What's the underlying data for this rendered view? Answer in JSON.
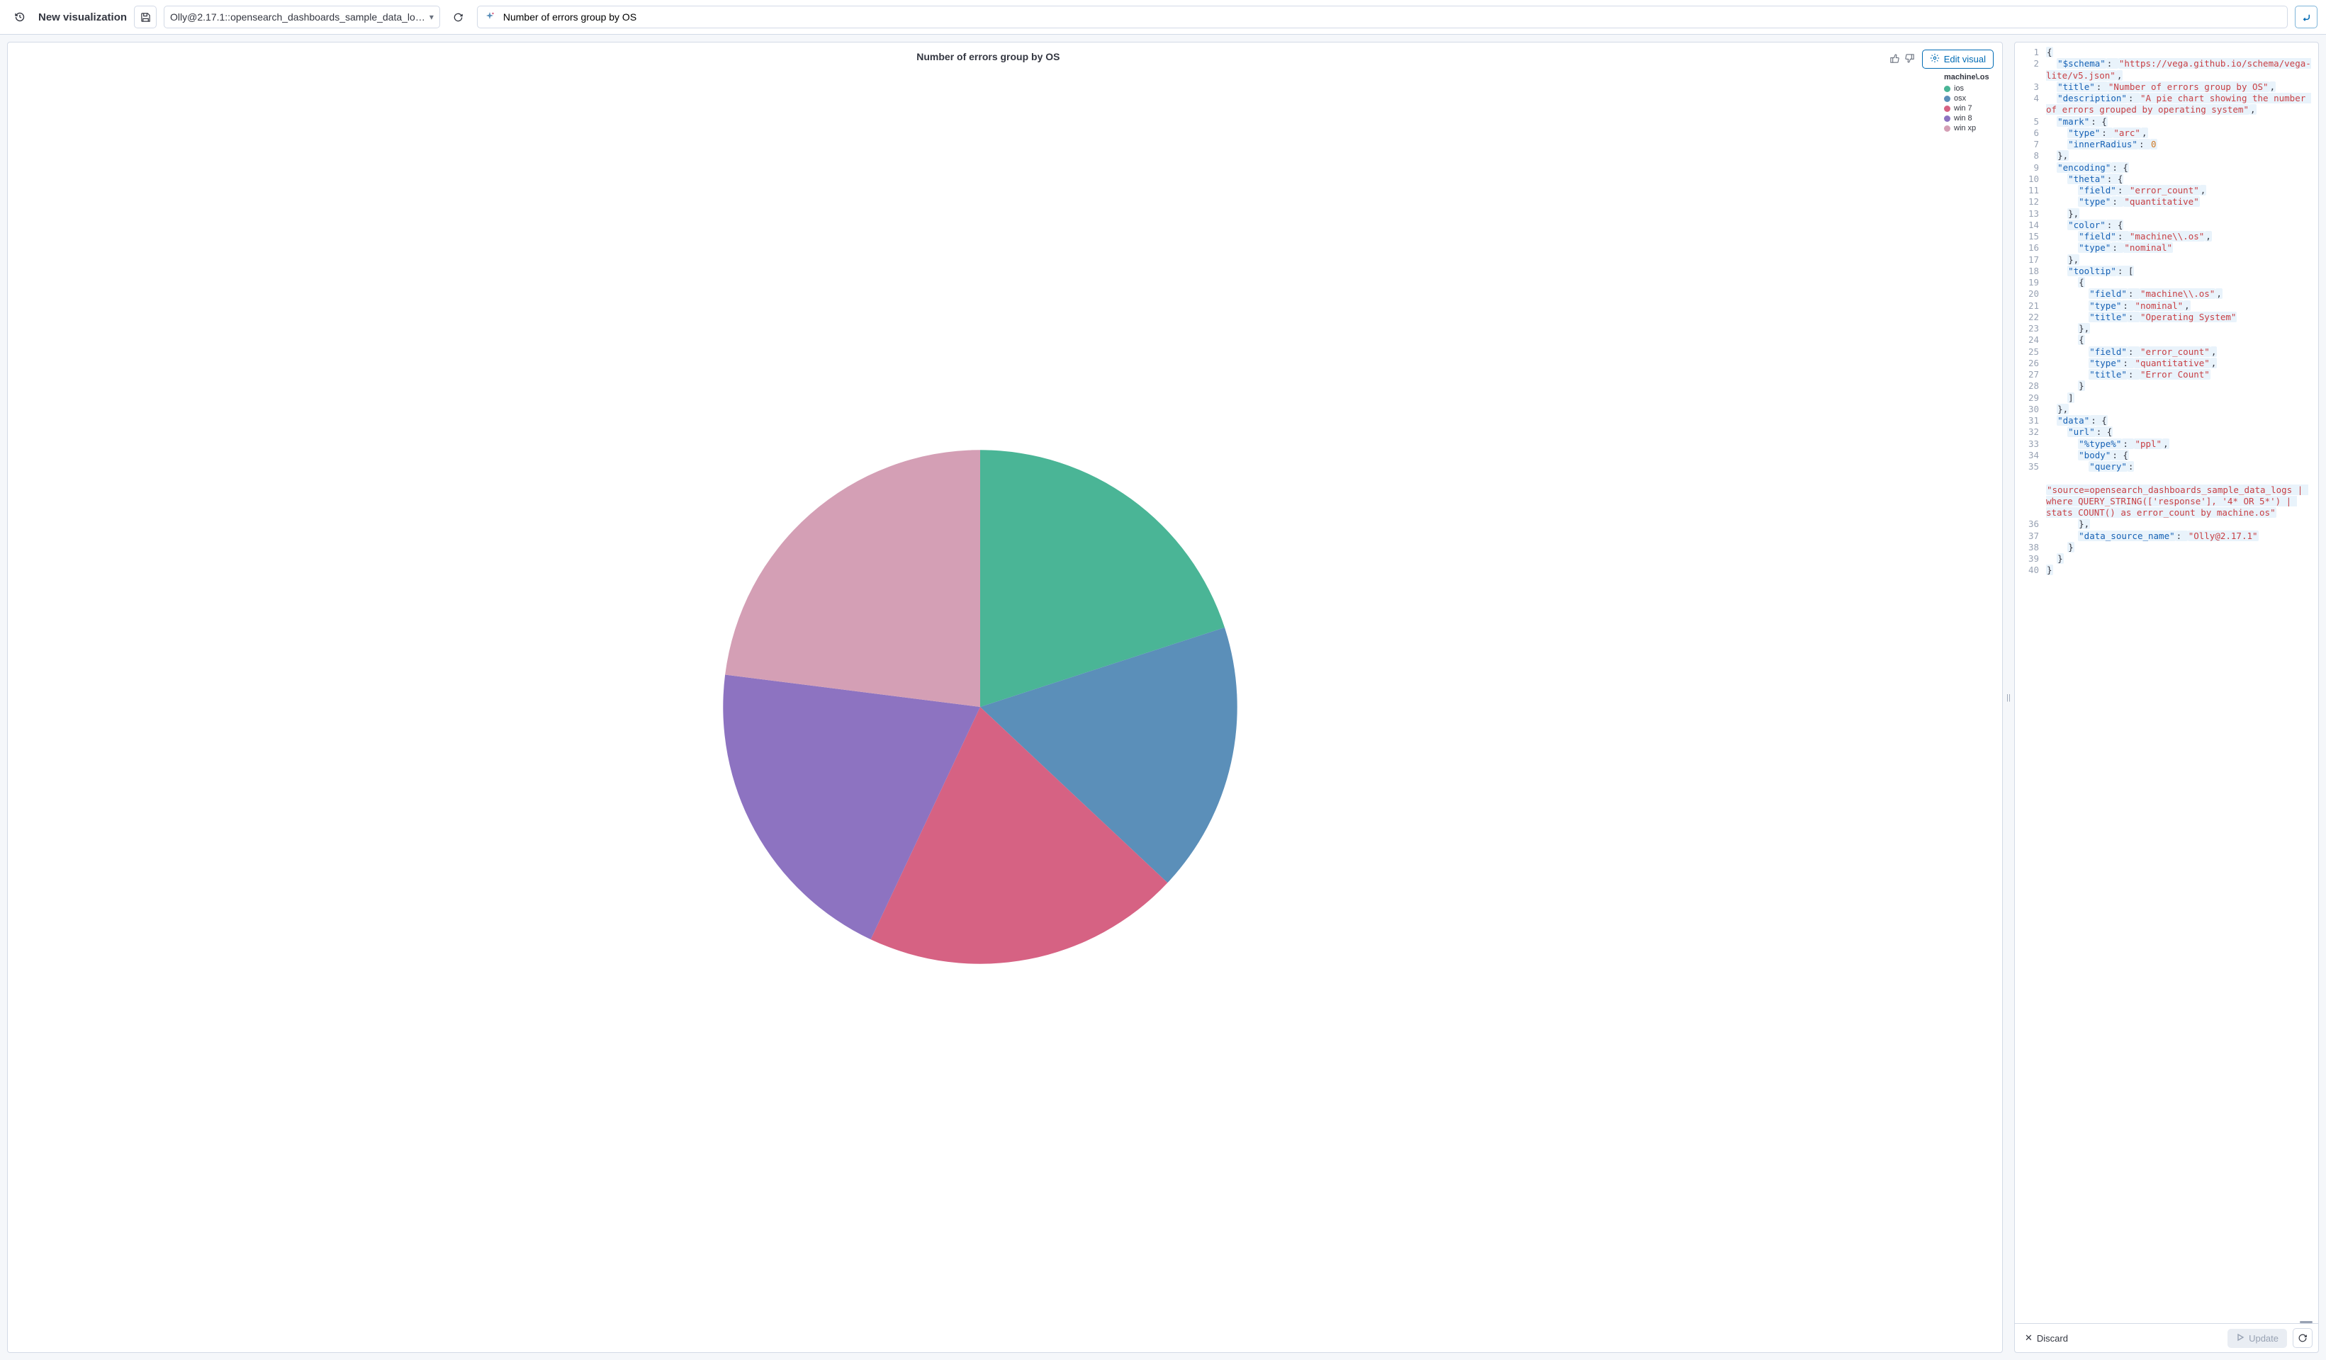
{
  "header": {
    "title": "New visualization",
    "datasource_label": "Olly@2.17.1::opensearch_dashboards_sample_data_lo…",
    "query_text": "Number of errors group by OS"
  },
  "viz": {
    "title": "Number of errors group by OS",
    "edit_label": "Edit visual",
    "legend_title": "machine\\.os"
  },
  "legend_items": [
    {
      "label": "ios",
      "color": "#4ab596"
    },
    {
      "label": "osx",
      "color": "#5b8fb9"
    },
    {
      "label": "win 7",
      "color": "#d66283"
    },
    {
      "label": "win 8",
      "color": "#8d73c1"
    },
    {
      "label": "win xp",
      "color": "#d49fb5"
    }
  ],
  "chart_data": {
    "type": "pie",
    "title": "Number of errors group by OS",
    "field": "machine\\.os",
    "slices": [
      {
        "category": "ios",
        "value": 20,
        "color": "#4ab596"
      },
      {
        "category": "osx",
        "value": 17,
        "color": "#5b8fb9"
      },
      {
        "category": "win 7",
        "value": 20,
        "color": "#d66283"
      },
      {
        "category": "win 8",
        "value": 20,
        "color": "#8d73c1"
      },
      {
        "category": "win xp",
        "value": 23,
        "color": "#d49fb5"
      }
    ]
  },
  "code": {
    "lines": [
      {
        "n": 1,
        "indent": 0,
        "tokens": [
          [
            "p",
            "{"
          ]
        ]
      },
      {
        "n": 2,
        "indent": 1,
        "tokens": [
          [
            "k",
            "\"$schema\""
          ],
          [
            "p",
            ": "
          ],
          [
            "s",
            "\"https://vega.github.io/schema/vega-lite/v5.json\""
          ],
          [
            "p",
            ","
          ]
        ]
      },
      {
        "n": 3,
        "indent": 1,
        "tokens": [
          [
            "k",
            "\"title\""
          ],
          [
            "p",
            ": "
          ],
          [
            "s",
            "\"Number of errors group by OS\""
          ],
          [
            "p",
            ","
          ]
        ]
      },
      {
        "n": 4,
        "indent": 1,
        "tokens": [
          [
            "k",
            "\"description\""
          ],
          [
            "p",
            ": "
          ],
          [
            "s",
            "\"A pie chart showing the number of errors grouped by operating system\""
          ],
          [
            "p",
            ","
          ]
        ]
      },
      {
        "n": 5,
        "indent": 1,
        "tokens": [
          [
            "k",
            "\"mark\""
          ],
          [
            "p",
            ": {"
          ]
        ]
      },
      {
        "n": 6,
        "indent": 2,
        "tokens": [
          [
            "k",
            "\"type\""
          ],
          [
            "p",
            ": "
          ],
          [
            "s",
            "\"arc\""
          ],
          [
            "p",
            ","
          ]
        ]
      },
      {
        "n": 7,
        "indent": 2,
        "tokens": [
          [
            "k",
            "\"innerRadius\""
          ],
          [
            "p",
            ": "
          ],
          [
            "n",
            "0"
          ]
        ]
      },
      {
        "n": 8,
        "indent": 1,
        "tokens": [
          [
            "p",
            "},"
          ]
        ]
      },
      {
        "n": 9,
        "indent": 1,
        "tokens": [
          [
            "k",
            "\"encoding\""
          ],
          [
            "p",
            ": {"
          ]
        ]
      },
      {
        "n": 10,
        "indent": 2,
        "tokens": [
          [
            "k",
            "\"theta\""
          ],
          [
            "p",
            ": {"
          ]
        ]
      },
      {
        "n": 11,
        "indent": 3,
        "tokens": [
          [
            "k",
            "\"field\""
          ],
          [
            "p",
            ": "
          ],
          [
            "s",
            "\"error_count\""
          ],
          [
            "p",
            ","
          ]
        ]
      },
      {
        "n": 12,
        "indent": 3,
        "tokens": [
          [
            "k",
            "\"type\""
          ],
          [
            "p",
            ": "
          ],
          [
            "s",
            "\"quantitative\""
          ]
        ]
      },
      {
        "n": 13,
        "indent": 2,
        "tokens": [
          [
            "p",
            "},"
          ]
        ]
      },
      {
        "n": 14,
        "indent": 2,
        "tokens": [
          [
            "k",
            "\"color\""
          ],
          [
            "p",
            ": {"
          ]
        ]
      },
      {
        "n": 15,
        "indent": 3,
        "tokens": [
          [
            "k",
            "\"field\""
          ],
          [
            "p",
            ": "
          ],
          [
            "s",
            "\"machine\\\\.os\""
          ],
          [
            "p",
            ","
          ]
        ]
      },
      {
        "n": 16,
        "indent": 3,
        "tokens": [
          [
            "k",
            "\"type\""
          ],
          [
            "p",
            ": "
          ],
          [
            "s",
            "\"nominal\""
          ]
        ]
      },
      {
        "n": 17,
        "indent": 2,
        "tokens": [
          [
            "p",
            "},"
          ]
        ]
      },
      {
        "n": 18,
        "indent": 2,
        "tokens": [
          [
            "k",
            "\"tooltip\""
          ],
          [
            "p",
            ": ["
          ]
        ]
      },
      {
        "n": 19,
        "indent": 3,
        "tokens": [
          [
            "p",
            "{"
          ]
        ]
      },
      {
        "n": 20,
        "indent": 4,
        "tokens": [
          [
            "k",
            "\"field\""
          ],
          [
            "p",
            ": "
          ],
          [
            "s",
            "\"machine\\\\.os\""
          ],
          [
            "p",
            ","
          ]
        ]
      },
      {
        "n": 21,
        "indent": 4,
        "tokens": [
          [
            "k",
            "\"type\""
          ],
          [
            "p",
            ": "
          ],
          [
            "s",
            "\"nominal\""
          ],
          [
            "p",
            ","
          ]
        ]
      },
      {
        "n": 22,
        "indent": 4,
        "tokens": [
          [
            "k",
            "\"title\""
          ],
          [
            "p",
            ": "
          ],
          [
            "s",
            "\"Operating System\""
          ]
        ]
      },
      {
        "n": 23,
        "indent": 3,
        "tokens": [
          [
            "p",
            "},"
          ]
        ]
      },
      {
        "n": 24,
        "indent": 3,
        "tokens": [
          [
            "p",
            "{"
          ]
        ]
      },
      {
        "n": 25,
        "indent": 4,
        "tokens": [
          [
            "k",
            "\"field\""
          ],
          [
            "p",
            ": "
          ],
          [
            "s",
            "\"error_count\""
          ],
          [
            "p",
            ","
          ]
        ]
      },
      {
        "n": 26,
        "indent": 4,
        "tokens": [
          [
            "k",
            "\"type\""
          ],
          [
            "p",
            ": "
          ],
          [
            "s",
            "\"quantitative\""
          ],
          [
            "p",
            ","
          ]
        ]
      },
      {
        "n": 27,
        "indent": 4,
        "tokens": [
          [
            "k",
            "\"title\""
          ],
          [
            "p",
            ": "
          ],
          [
            "s",
            "\"Error Count\""
          ]
        ]
      },
      {
        "n": 28,
        "indent": 3,
        "tokens": [
          [
            "p",
            "}"
          ]
        ]
      },
      {
        "n": 29,
        "indent": 2,
        "tokens": [
          [
            "p",
            "]"
          ]
        ]
      },
      {
        "n": 30,
        "indent": 1,
        "tokens": [
          [
            "p",
            "},"
          ]
        ]
      },
      {
        "n": 31,
        "indent": 1,
        "tokens": [
          [
            "k",
            "\"data\""
          ],
          [
            "p",
            ": {"
          ]
        ]
      },
      {
        "n": 32,
        "indent": 2,
        "tokens": [
          [
            "k",
            "\"url\""
          ],
          [
            "p",
            ": {"
          ]
        ]
      },
      {
        "n": 33,
        "indent": 3,
        "tokens": [
          [
            "k",
            "\"%type%\""
          ],
          [
            "p",
            ": "
          ],
          [
            "s",
            "\"ppl\""
          ],
          [
            "p",
            ","
          ]
        ]
      },
      {
        "n": 34,
        "indent": 3,
        "tokens": [
          [
            "k",
            "\"body\""
          ],
          [
            "p",
            ": {"
          ]
        ]
      },
      {
        "n": 35,
        "indent": 4,
        "tokens": [
          [
            "k",
            "\"query\""
          ],
          [
            "p",
            ":"
          ]
        ]
      },
      {
        "n": "",
        "indent": 5,
        "tokens": [
          [
            "s",
            "\"source=opensearch_dashboards_sample_data_logs | where QUERY_STRING(['response'], '4* OR 5*') | stats COUNT() as error_count by machine.os\""
          ]
        ]
      },
      {
        "n": 36,
        "indent": 3,
        "tokens": [
          [
            "p",
            "},"
          ]
        ]
      },
      {
        "n": 37,
        "indent": 3,
        "tokens": [
          [
            "k",
            "\"data_source_name\""
          ],
          [
            "p",
            ": "
          ],
          [
            "s",
            "\"Olly@2.17.1\""
          ]
        ]
      },
      {
        "n": 38,
        "indent": 2,
        "tokens": [
          [
            "p",
            "}"
          ]
        ]
      },
      {
        "n": 39,
        "indent": 1,
        "tokens": [
          [
            "p",
            "}"
          ]
        ]
      },
      {
        "n": 40,
        "indent": 0,
        "tokens": [
          [
            "p",
            "}"
          ]
        ]
      }
    ]
  },
  "footer": {
    "discard_label": "Discard",
    "update_label": "Update"
  }
}
